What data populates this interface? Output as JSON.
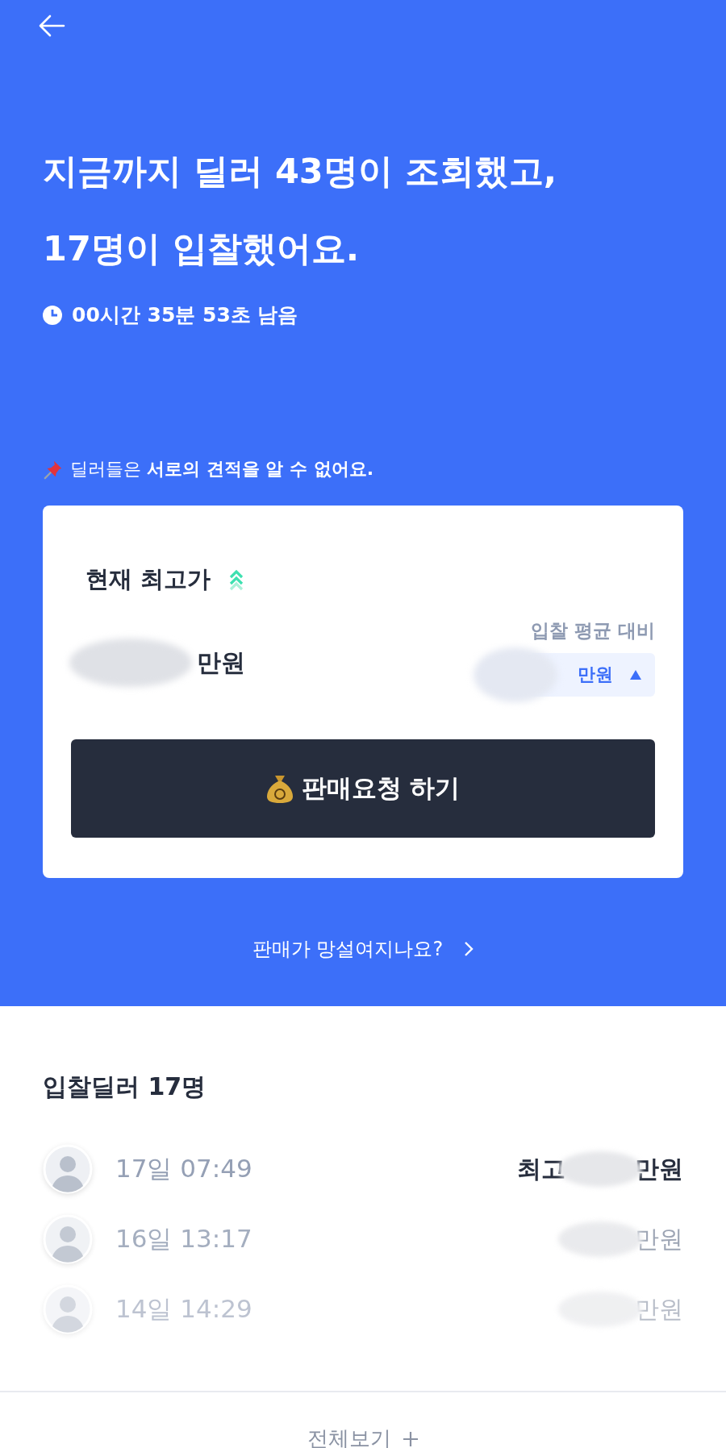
{
  "header": {
    "title_lines": [
      "지금까지 딜러 43명이 조회했고,",
      "17명이 입찰했어요."
    ],
    "timer": "00시간 35분 53초 남음"
  },
  "notice": {
    "text": "딜러들은 **서로의 견적을 알 수 없어요.**"
  },
  "card": {
    "title": "현재 최고가",
    "amount_unit": "만원",
    "compare_label": "입찰 평균 대비",
    "compare_value": "만원",
    "rising": true,
    "sell_button": "판매요청 하기"
  },
  "help_link": "판매가 망설여지나요?",
  "bidders": {
    "title": "입찰딜러 17명",
    "rows": [
      {
        "time": "17일 07:49",
        "prefix": "최고",
        "amount_unit": "만원",
        "highlight": true
      },
      {
        "time": "16일 13:17",
        "amount_unit": "만원",
        "highlight": false
      },
      {
        "time": "14일 14:29",
        "amount_unit": "만원",
        "highlight": false
      }
    ],
    "view_all": "전체보기"
  }
}
